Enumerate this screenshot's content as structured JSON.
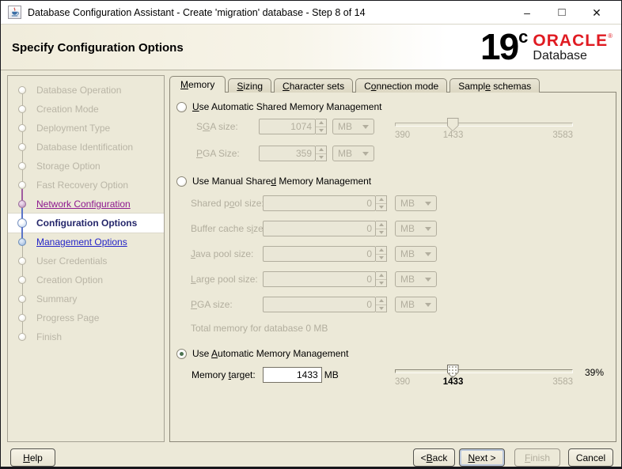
{
  "window": {
    "title": "Database Configuration Assistant - Create 'migration' database - Step 8 of 14",
    "controls": {
      "minimize": "–",
      "maximize": "□",
      "close": "✕"
    }
  },
  "header": {
    "title": "Specify Configuration Options",
    "logo": {
      "product": "19",
      "edition": "c",
      "brand": "ORACLE",
      "registered": "®",
      "line2": "Database"
    }
  },
  "sidebar": {
    "items": [
      {
        "label": "Database Operation",
        "state": "future",
        "line": "none"
      },
      {
        "label": "Creation Mode",
        "state": "future",
        "line": "gray"
      },
      {
        "label": "Deployment Type",
        "state": "future",
        "line": "gray"
      },
      {
        "label": "Database Identification",
        "state": "future",
        "line": "gray"
      },
      {
        "label": "Storage Option",
        "state": "future",
        "line": "gray"
      },
      {
        "label": "Fast Recovery Option",
        "state": "future",
        "line": "gray"
      },
      {
        "label": "Network Configuration",
        "state": "visited-purple",
        "line": "purple"
      },
      {
        "label": "Configuration Options",
        "state": "current",
        "line": "blue"
      },
      {
        "label": "Management Options",
        "state": "visited-blue",
        "line": "blue"
      },
      {
        "label": "User Credentials",
        "state": "future",
        "line": "gray"
      },
      {
        "label": "Creation Option",
        "state": "future",
        "line": "gray"
      },
      {
        "label": "Summary",
        "state": "future",
        "line": "gray"
      },
      {
        "label": "Progress Page",
        "state": "future",
        "line": "gray"
      },
      {
        "label": "Finish",
        "state": "future",
        "line": "gray"
      }
    ]
  },
  "tabs": {
    "items": [
      {
        "label": "&Memory",
        "selected": true
      },
      {
        "label": "&Sizing",
        "selected": false
      },
      {
        "label": "&Character sets",
        "selected": false
      },
      {
        "label": "C&onnection mode",
        "selected": false
      },
      {
        "label": "Sampl&e schemas",
        "selected": false
      }
    ]
  },
  "memory": {
    "asmm": {
      "label": "&Use Automatic Shared Memory Management",
      "selected": false,
      "sga": {
        "label": "S&GA size:",
        "value": "1074",
        "unit": "MB"
      },
      "pga": {
        "label": "&PGA Size:",
        "value": "359",
        "unit": "MB"
      },
      "slider": {
        "min": "390",
        "current": "1433",
        "max": "3583"
      }
    },
    "msmm": {
      "label": "Use Manual Share&d Memory Management",
      "selected": false,
      "fields": [
        {
          "label": "Shared p&ool size:",
          "value": "0",
          "unit": "MB"
        },
        {
          "label": "Buffer cache s&ize:",
          "value": "0",
          "unit": "MB"
        },
        {
          "label": "&Java pool size:",
          "value": "0",
          "unit": "MB"
        },
        {
          "label": "&Large pool size:",
          "value": "0",
          "unit": "MB"
        },
        {
          "label": "&PGA size:",
          "value": "0",
          "unit": "MB"
        }
      ],
      "total": "Total memory for database 0 MB"
    },
    "amm": {
      "label": "Use &Automatic Memory Management",
      "selected": true,
      "target": {
        "label": "Memory &target:",
        "value": "1433",
        "unit": "MB"
      },
      "slider": {
        "min": "390",
        "current": "1433",
        "max": "3583",
        "percent": "39%"
      }
    }
  },
  "footer": {
    "help": "&Help",
    "back": "< &Back",
    "next": "&Next >",
    "finish": "&Finish",
    "cancel": "Cancel"
  },
  "colors": {
    "accent_red": "#e01b22",
    "visited_purple": "#8e188f",
    "visited_blue": "#2424c8",
    "current_navy": "#24266a",
    "disabled_gray": "#b2ae9e",
    "panel_beige": "#ece9d8"
  }
}
